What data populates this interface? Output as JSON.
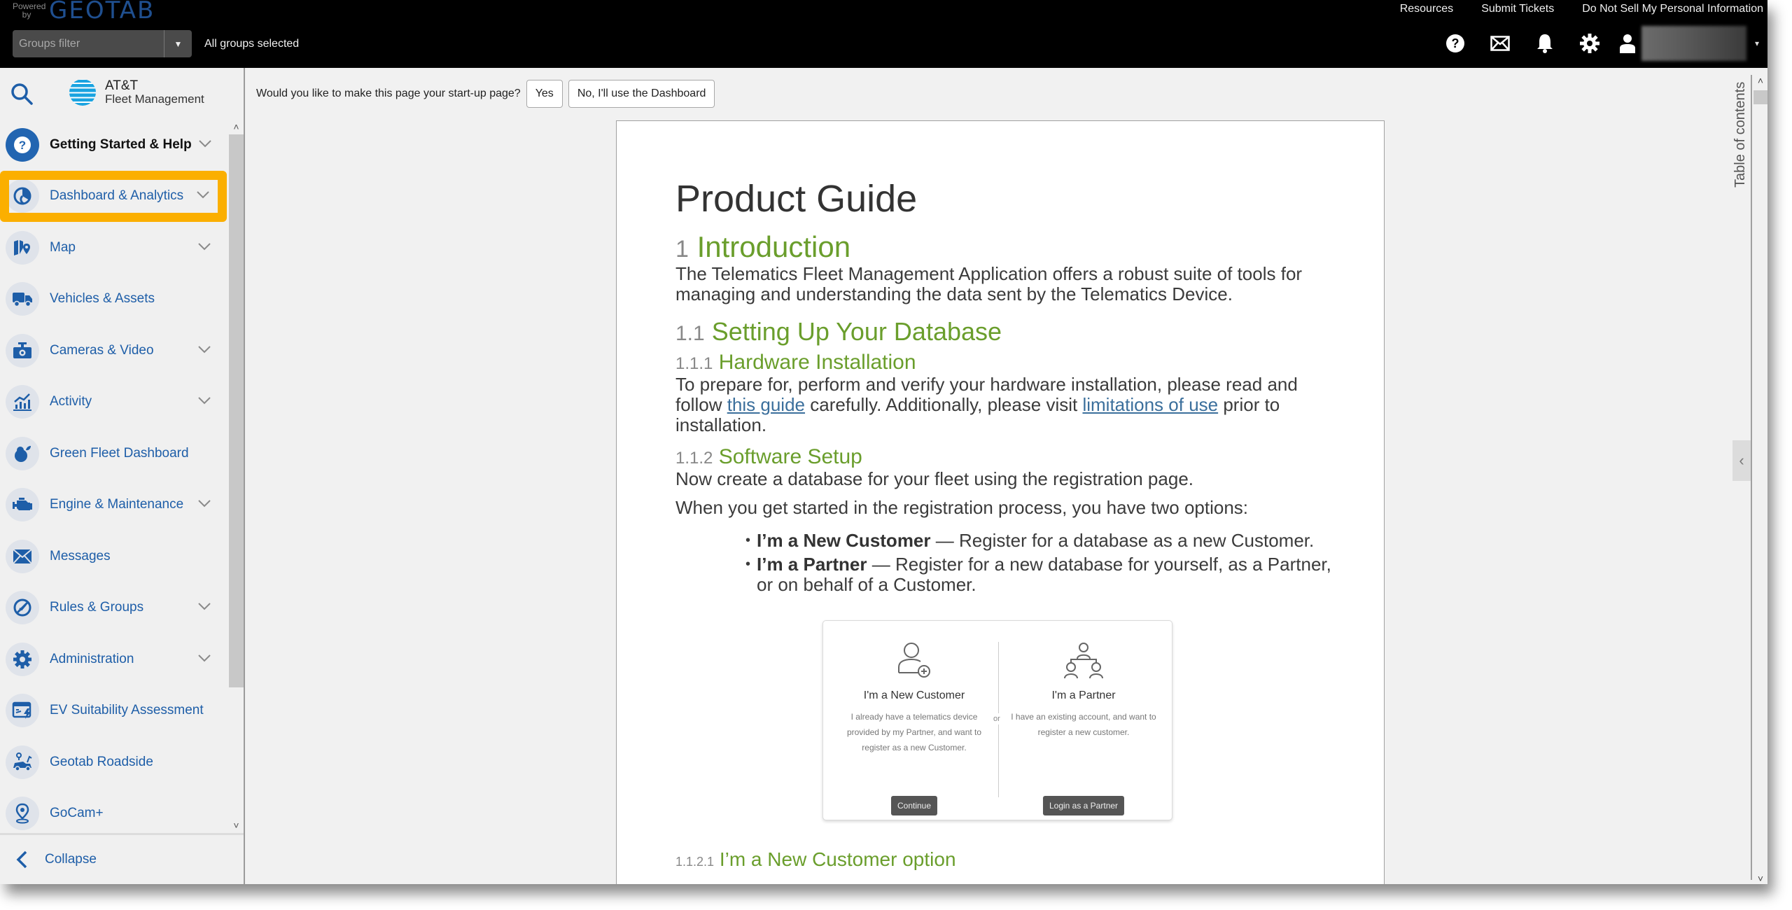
{
  "header": {
    "brand": {
      "powered_by": "Powered by",
      "name": "GEOTAB"
    },
    "links": [
      "Resources",
      "Submit Tickets",
      "Do Not Sell My Personal Information"
    ],
    "groups_filter": {
      "placeholder": "Groups filter",
      "status": "All groups selected"
    },
    "icons": [
      "help-icon",
      "mail-icon",
      "bell-icon",
      "gear-icon",
      "user-icon"
    ],
    "user_caret": "▾"
  },
  "sidebar": {
    "logo": {
      "line1": "AT&T",
      "line2": "Fleet Management"
    },
    "items": [
      {
        "label": "Getting Started & Help",
        "icon": "help-icon",
        "expandable": true,
        "bold": true
      },
      {
        "label": "Dashboard & Analytics",
        "icon": "pie-chart-icon",
        "expandable": true,
        "highlighted": true
      },
      {
        "label": "Map",
        "icon": "map-icon",
        "expandable": true
      },
      {
        "label": "Vehicles & Assets",
        "icon": "truck-icon",
        "expandable": false
      },
      {
        "label": "Cameras & Video",
        "icon": "camera-icon",
        "expandable": true
      },
      {
        "label": "Activity",
        "icon": "activity-chart-icon",
        "expandable": true
      },
      {
        "label": "Green Fleet Dashboard",
        "icon": "green-fleet-icon",
        "expandable": false
      },
      {
        "label": "Engine & Maintenance",
        "icon": "engine-icon",
        "expandable": true
      },
      {
        "label": "Messages",
        "icon": "envelope-icon",
        "expandable": false
      },
      {
        "label": "Rules & Groups",
        "icon": "rules-icon",
        "expandable": true
      },
      {
        "label": "Administration",
        "icon": "gear-icon",
        "expandable": true
      },
      {
        "label": "EV Suitability Assessment",
        "icon": "ev-icon",
        "expandable": false
      },
      {
        "label": "Geotab Roadside",
        "icon": "roadside-icon",
        "expandable": false
      },
      {
        "label": "GoCam+",
        "icon": "gocam-icon",
        "expandable": false
      }
    ],
    "collapse_label": "Collapse"
  },
  "startup_prompt": {
    "question": "Would you like to make this page your start-up page?",
    "yes": "Yes",
    "no": "No, I'll use the Dashboard"
  },
  "document": {
    "title": "Product Guide",
    "sections": {
      "s1": {
        "num": "1",
        "title": "Introduction"
      },
      "s1_text": "The Telematics Fleet Management Application offers a robust suite of tools for managing and understanding the data sent by the Telematics Device.",
      "s11": {
        "num": "1.1",
        "title": "Setting Up Your Database"
      },
      "s111": {
        "num": "1.1.1",
        "title": "Hardware Installation"
      },
      "s111_text": {
        "pre": "To prepare for, perform and verify your hardware installation, please read and follow ",
        "link1": "this guide",
        "mid": " carefully. Additionally, please visit ",
        "link2": "limitations of use",
        "post": " prior to installation."
      },
      "s112": {
        "num": "1.1.2",
        "title": "Software Setup"
      },
      "s112_text1": "Now create a database for your fleet using the registration page.",
      "s112_text2": "When you get started in the registration process, you have two options:",
      "bullets": [
        {
          "bold": "I’m a New Customer",
          "text": " — Register for a database as a new Customer."
        },
        {
          "bold": "I’m a Partner",
          "text": " — Register for a new database for yourself, as a Partner, or on behalf of a Customer."
        }
      ],
      "s1121": {
        "num": "1.1.2.1",
        "title": "I’m a New Customer option"
      }
    },
    "registration_card": {
      "customer": {
        "heading": "I'm a New Customer",
        "description": "I already have a telematics device provided by my Partner, and want to register as a new Customer.",
        "button": "Continue"
      },
      "or": "or",
      "partner": {
        "heading": "I'm a Partner",
        "description": "I have an existing account, and want to register a new customer.",
        "button": "Login as a Partner"
      }
    }
  },
  "toc": {
    "label": "Table of contents"
  },
  "colors": {
    "accent_blue": "#1e5ea8",
    "highlight_orange": "#fbaf00",
    "heading_green": "#6a9e2c",
    "topbar": "#000000"
  }
}
